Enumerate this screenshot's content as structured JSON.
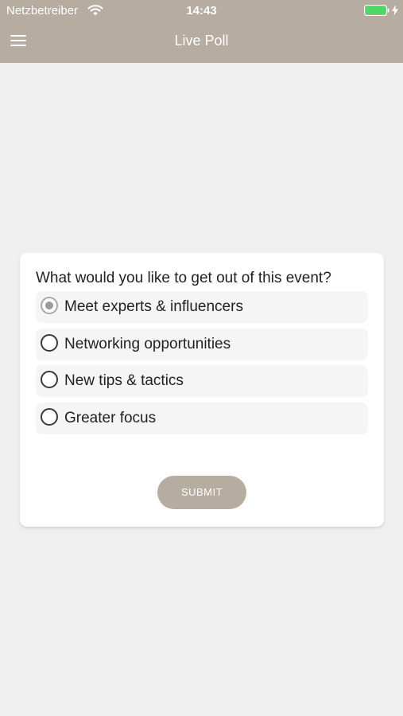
{
  "status_bar": {
    "carrier": "Netzbetreiber",
    "time": "14:43",
    "wifi_icon": "wifi-icon",
    "battery_icon": "battery-icon",
    "battery_color": "#4cd964"
  },
  "nav": {
    "title": "Live Poll",
    "menu_icon": "hamburger-menu-icon",
    "bar_color": "#b6aca0"
  },
  "poll": {
    "question": "What would you like to get out of this event?",
    "options": [
      {
        "label": "Meet experts & influencers",
        "selected": true
      },
      {
        "label": "Networking opportunities",
        "selected": false
      },
      {
        "label": "New tips & tactics",
        "selected": false
      },
      {
        "label": "Greater focus",
        "selected": false
      }
    ],
    "submit_label": "SUBMIT"
  }
}
